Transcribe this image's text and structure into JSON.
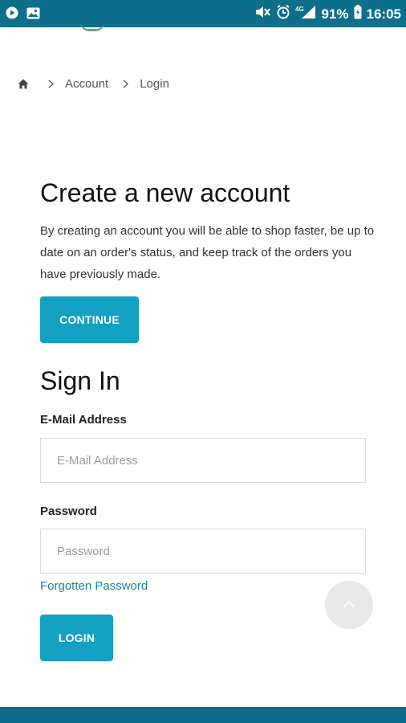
{
  "status_bar": {
    "battery": "91%",
    "time": "16:05",
    "network": "4G",
    "icons": [
      "play-icon",
      "image-icon",
      "mute-icon",
      "alarm-icon",
      "signal-icon",
      "battery-icon"
    ]
  },
  "breadcrumb": {
    "home_icon": "home-icon",
    "items": [
      "Account",
      "Login"
    ]
  },
  "create_account": {
    "title": "Create a new account",
    "description": "By creating an account you will be able to shop faster, be up to date on an order's status, and keep track of the orders you have previously made.",
    "continue_label": "CONTINUE"
  },
  "sign_in": {
    "title": "Sign In",
    "email_label": "E-Mail Address",
    "email_placeholder": "E-Mail Address",
    "email_value": "",
    "password_label": "Password",
    "password_placeholder": "Password",
    "password_value": "",
    "forgot_label": "Forgotten Password",
    "login_label": "LOGIN"
  },
  "scroll_top": {
    "icon": "chevron-up-icon"
  },
  "colors": {
    "status_bar": "#0e6f8a",
    "accent": "#14a0c3",
    "link": "#1a7fa0",
    "footer": "#0e6f8a"
  }
}
